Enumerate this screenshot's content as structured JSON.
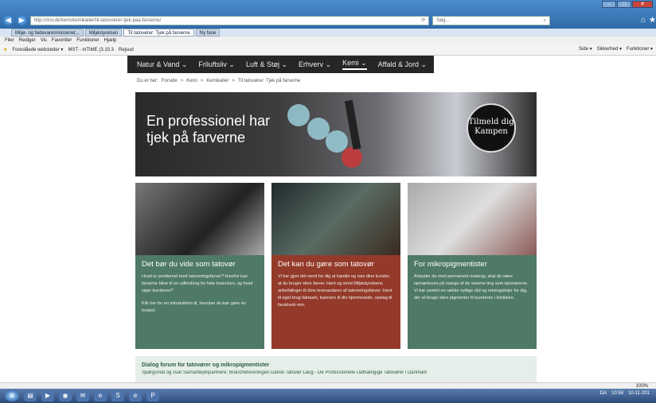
{
  "browser": {
    "url": "http://mst.dk/kemi/kemikalier/til-tatovoerer-tjek-paa-farverne/",
    "search_placeholder": "Søg...",
    "tabs": [
      {
        "label": "Miljø- og fødevareministeriet..."
      },
      {
        "label": "Miljøstyrelsen"
      },
      {
        "label": "Til tatovører: Tjek på farverne"
      },
      {
        "label": "Ny fane"
      }
    ],
    "menu": [
      "Filer",
      "Rediger",
      "Vis",
      "Favoritter",
      "Funktioner",
      "Hjælp"
    ],
    "favorites": [
      "Foreslåede websteder ▾",
      "MST - mTIME (3.10.3",
      "Rejsud"
    ],
    "toolbar_right": [
      "Side ▾",
      "Sikkerhed ▾",
      "Funktioner ▾"
    ],
    "zoom": "100%"
  },
  "site_nav": [
    "Natur & Vand ⌄",
    "Friluftsliv ⌄",
    "Luft & Støj ⌄",
    "Erhverv ⌄",
    "Kemi ⌄",
    "Affald & Jord ⌄"
  ],
  "breadcrumb": [
    "Du er her:",
    "Forside",
    ">",
    "Kemi",
    ">",
    "Kemikalier",
    ">",
    "Til tatovører: Tjek på farverne"
  ],
  "hero": {
    "line1": "En professionel har",
    "line2": "tjek på farverne",
    "badge_line1": "Tilmeld dig",
    "badge_line2": "Kampen"
  },
  "cards": [
    {
      "title": "Det bør du vide som tatovør",
      "text1": "Hvad er problemet med tatoveringsfarver? Hvorfor kan farverne blive til en udfordring for hele branchen, og hvad siger kunderne?",
      "text2": "Klik her for en introduktion til, hvordan du kan gøre en forskel."
    },
    {
      "title": "Det kan du gøre som tatovør",
      "text1": "Vi har gjort det nemt for dig at handle og vise dine kunder, at du bruger sikre farver. Hent og send Miljøstyrelsens anbefalinger til dine leverandører af tatoveringsfarver. Hent til eget brug faktaark, bannere til din hjemmeside, opslag til facebook mm."
    },
    {
      "title": "For mikropigmentister",
      "text1": "Arbejder du med permanent makeup, skal du være opmærksom på mange af de samme ting som tatovørerne. Vi har samlet en række nyttige råd og retningslinjer for dig, der vil bruge sikre pigmenter til kunderne i klinikken."
    }
  ],
  "dialog": {
    "title": "Dialog forum for tatovører og mikropigmentister",
    "text": "Spørgsmål og svar Samarbejdspartnere: Brancheforeningen Dansk Tatovør Laug - De Professionelle Uafhængige Tatovører i Danmark"
  },
  "taskbar": {
    "lang": "DA",
    "time": "10:58",
    "date": "10-11-201"
  }
}
